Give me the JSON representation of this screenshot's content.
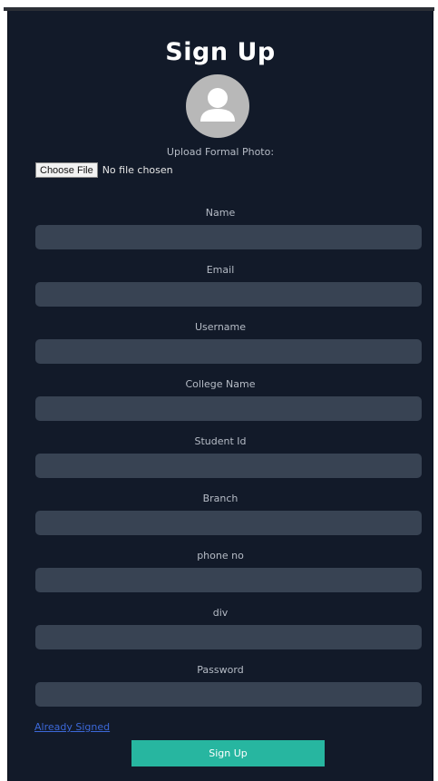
{
  "form": {
    "title": "Sign Up",
    "upload_label": "Upload Formal Photo:",
    "choose_file_label": "Choose File",
    "no_file_text": "No file chosen",
    "fields": [
      {
        "label": "Name",
        "value": ""
      },
      {
        "label": "Email",
        "value": ""
      },
      {
        "label": "Username",
        "value": ""
      },
      {
        "label": "College Name",
        "value": ""
      },
      {
        "label": "Student Id",
        "value": ""
      },
      {
        "label": "Branch",
        "value": ""
      },
      {
        "label": "phone no",
        "value": ""
      },
      {
        "label": "div",
        "value": ""
      },
      {
        "label": "Password",
        "value": ""
      }
    ],
    "already_signed_link": "Already Signed",
    "submit_label": "Sign Up"
  },
  "colors": {
    "background": "#121a29",
    "input": "#384353",
    "accent": "#27b6a0",
    "link": "#3c68d8"
  },
  "icons": {
    "avatar": "user-placeholder-icon"
  }
}
